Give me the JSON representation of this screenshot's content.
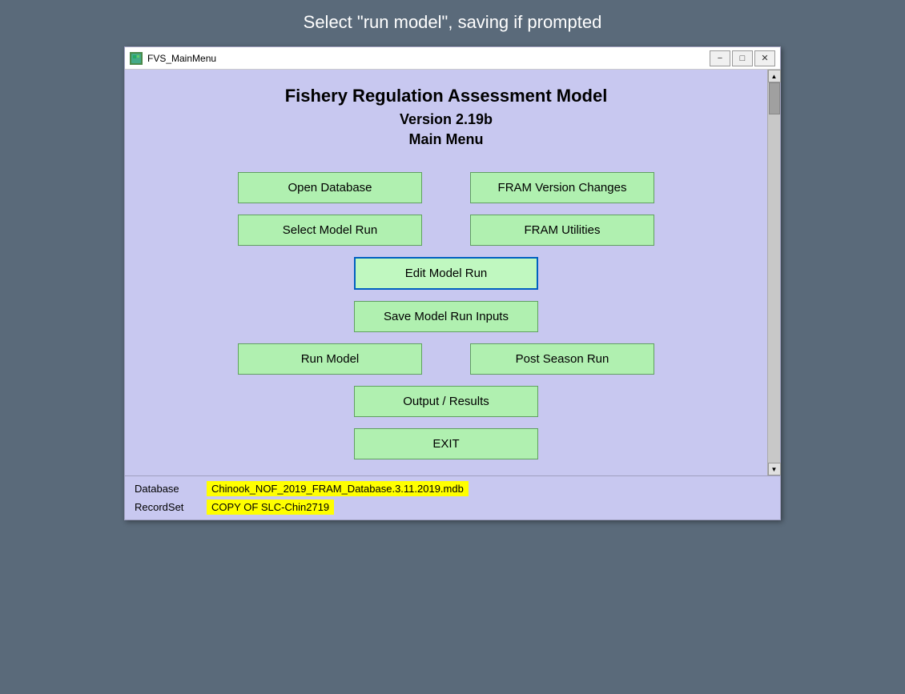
{
  "instruction": {
    "text": "Select \"run model\", saving if prompted"
  },
  "window": {
    "title": "FVS_MainMenu",
    "title_icon": "🌿"
  },
  "titlebar": {
    "minimize_label": "−",
    "maximize_label": "□",
    "close_label": "✕"
  },
  "app": {
    "title": "Fishery Regulation Assessment Model",
    "version": "Version 2.19b",
    "menu_label": "Main Menu"
  },
  "buttons": {
    "open_database": "Open Database",
    "fram_version_changes": "FRAM Version Changes",
    "select_model_run": "Select Model Run",
    "fram_utilities": "FRAM Utilities",
    "edit_model_run": "Edit Model Run",
    "save_model_run_inputs": "Save Model Run Inputs",
    "run_model": "Run Model",
    "post_season_run": "Post Season Run",
    "output_results": "Output / Results",
    "exit": "EXIT"
  },
  "status": {
    "database_label": "Database",
    "database_value": "Chinook_NOF_2019_FRAM_Database.3.11.2019.mdb",
    "recordset_label": "RecordSet",
    "recordset_value": "COPY OF SLC-Chin2719"
  },
  "scrollbar": {
    "up_arrow": "▲",
    "down_arrow": "▼"
  }
}
